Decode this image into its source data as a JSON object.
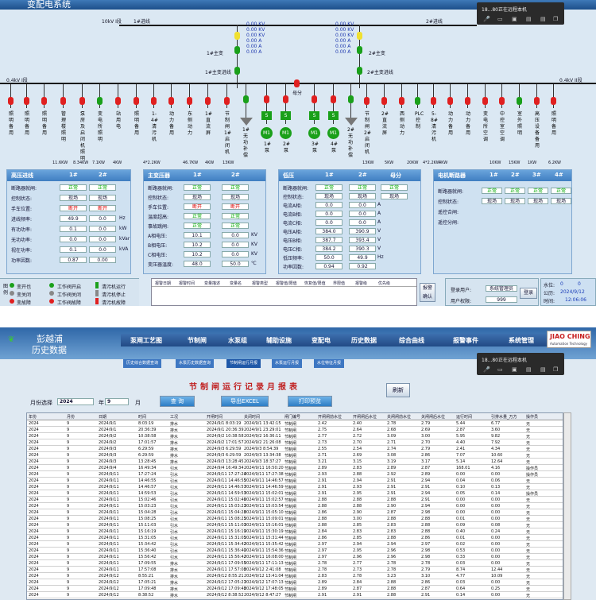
{
  "screen1": {
    "window_title": "变配电系统",
    "recorder": {
      "title": "18...80正在远程本机",
      "icons": [
        "microphone-icon",
        "video-icon",
        "monitor-icon",
        "folder-icon",
        "folder-icon",
        "window-icon"
      ]
    },
    "bus_10kv_1": "10kV I段",
    "bus_10kv_2": "2#进线",
    "incoming_1": "1#进线",
    "transformer_1": "1#主变",
    "transformer_2": "2#主变",
    "transformer_1_line": "1#主变进线",
    "transformer_2_line": "2#主变进线",
    "kv_readouts_left": [
      "0.00 KV",
      "0.00 KV",
      "0.00 KV",
      "0.00 A",
      "0.00 A",
      "0.00 A"
    ],
    "kv_readouts_right": [
      "0.00 KV",
      "0.00 KV",
      "0.00 KV",
      "0.00 A",
      "0.00 A",
      "0.00 A"
    ],
    "low_bus_left": "0.4kV I段",
    "low_bus_right": "0.4kV II段",
    "bus_coupler": "母分",
    "feeders_left": [
      "照明备用",
      "照明备用",
      "照明备用",
      "管理楼照明",
      "泵房及启闭机照明",
      "变电所照明",
      "站用电",
      "照明备用",
      "1-4#清污机",
      "动力备用",
      "东侧动力",
      "1#直流屏",
      "节制闸1#启闭机"
    ],
    "pump_labels": [
      "1#无功补偿",
      "1#泵",
      "2#泵",
      "3#泵",
      "4#泵",
      "2#无功补偿"
    ],
    "motor_label": "M1",
    "s_label": "S",
    "feeders_right": [
      "节制闸2#启闭机",
      "2#直流屏",
      "西侧动力",
      "PLC控制",
      "5-8#清污机",
      "动力备用",
      "动力备用",
      "变电所空调",
      "中控室空调",
      "室外照明",
      "高压设备备用",
      "照明备用"
    ],
    "feeder_powers": [
      "11.6KW",
      "8.34KW",
      "7.1KW",
      "4KW",
      "4*2.2KW",
      "46.7KW",
      "4KW",
      "13KW",
      "13KW",
      "5KW",
      "20KW",
      "4*2.2KW",
      "4KW",
      "10KW",
      "15KW",
      "1KW",
      "6.2KW"
    ],
    "panels": {
      "hv": {
        "title": "高压进线",
        "cols": [
          "1#",
          "2#"
        ],
        "rows": [
          {
            "label": "断路器就闸:",
            "v1": "正常",
            "v2": "正常",
            "u": ""
          },
          {
            "label": "控制状态:",
            "v1": "现场",
            "v2": "现场",
            "u": ""
          },
          {
            "label": "手车位置:",
            "v1": "断开",
            "v2": "断开",
            "u": ""
          },
          {
            "label": "进线频率:",
            "v1": "49.9",
            "v2": "0.0",
            "u": "Hz"
          },
          {
            "label": "有功功率:",
            "v1": "0.1",
            "v2": "0.0",
            "u": "kW"
          },
          {
            "label": "无功功率:",
            "v1": "0.0",
            "v2": "0.0",
            "u": "kVar"
          },
          {
            "label": "视在功率:",
            "v1": "0.1",
            "v2": "0.0",
            "u": "kVA"
          },
          {
            "label": "功率因数:",
            "v1": "0.87",
            "v2": "0.00",
            "u": ""
          }
        ]
      },
      "tr": {
        "title": "主变压器",
        "cols": [
          "1#",
          "2#"
        ],
        "rows": [
          {
            "label": "断路器就闸:",
            "v1": "正常",
            "v2": "正常",
            "u": ""
          },
          {
            "label": "控制状态:",
            "v1": "现场",
            "v2": "现场",
            "u": ""
          },
          {
            "label": "手车位置:",
            "v1": "断开",
            "v2": "断开",
            "u": ""
          },
          {
            "label": "温度超高:",
            "v1": "正常",
            "v2": "正常",
            "u": ""
          },
          {
            "label": "事故跳闸:",
            "v1": "正常",
            "v2": "正常",
            "u": ""
          },
          {
            "label": "A相电压:",
            "v1": "10.1",
            "v2": "0.0",
            "u": "KV"
          },
          {
            "label": "B相电压:",
            "v1": "10.2",
            "v2": "0.0",
            "u": "KV"
          },
          {
            "label": "C相电压:",
            "v1": "10.2",
            "v2": "0.0",
            "u": "KV"
          },
          {
            "label": "变压器温度:",
            "v1": "48.0",
            "v2": "50.0",
            "u": "℃"
          }
        ]
      },
      "lv": {
        "title": "低压",
        "cols": [
          "1#",
          "2#",
          "母分"
        ],
        "rows": [
          {
            "label": "断路器就闸:",
            "v1": "正常",
            "v2": "正常",
            "v3": "正常",
            "u": ""
          },
          {
            "label": "控制状态:",
            "v1": "现场",
            "v2": "现场",
            "v3": "现场",
            "u": ""
          },
          {
            "label": "电流A相:",
            "v1": "0.0",
            "v2": "0.0",
            "u": "A"
          },
          {
            "label": "电流B相:",
            "v1": "0.0",
            "v2": "0.0",
            "u": "A"
          },
          {
            "label": "电流C相:",
            "v1": "0.0",
            "v2": "0.0",
            "u": "A"
          },
          {
            "label": "电压A相:",
            "v1": "384.0",
            "v2": "390.9",
            "u": "V"
          },
          {
            "label": "电压B相:",
            "v1": "387.7",
            "v2": "393.4",
            "u": "V"
          },
          {
            "label": "电压C相:",
            "v1": "384.2",
            "v2": "390.3",
            "u": "V"
          },
          {
            "label": "低压频率:",
            "v1": "50.0",
            "v2": "49.9",
            "u": "Hz"
          },
          {
            "label": "功率因数:",
            "v1": "0.94",
            "v2": "0.92",
            "u": ""
          }
        ]
      },
      "motor": {
        "title": "电机断路器",
        "cols": [
          "1#",
          "2#",
          "3#",
          "4#"
        ],
        "rows": [
          {
            "label": "断路器就闸:",
            "v": [
              "正常",
              "正常",
              "正常",
              "正常"
            ]
          },
          {
            "label": "控制状态:",
            "v": [
              "现场",
              "现场",
              "现场",
              "现场"
            ]
          },
          {
            "label": "遥控合闸:",
            "v": []
          },
          {
            "label": "遥控分闸:",
            "v": []
          }
        ]
      }
    },
    "legend": {
      "title": "图例",
      "items": [
        "变开也",
        "变关闭",
        "变故障",
        "工作阀开启",
        "工作阀关闭",
        "工作阀故障",
        "清污机运行",
        "清污机停止",
        "清污机故障"
      ]
    },
    "event_table_headers": [
      "报警日期",
      "报警时间",
      "变量描述",
      "变量名",
      "报警类型",
      "报警值/限值",
      "恢复值/限值",
      "界限值",
      "报警级",
      "优先级"
    ],
    "alarm_confirm": [
      "报警",
      "确认"
    ],
    "login": {
      "user_label": "登录用户:",
      "user": "系统管理员",
      "perm_label": "用户权限:",
      "perm": "999",
      "button": "登录"
    },
    "status": {
      "water_label": "水位:",
      "water_a": "0",
      "water_b": "0",
      "date_label": "公历:",
      "date": "2024/9/12",
      "time_label": "时间:",
      "time": "12:06:06"
    }
  },
  "screen2": {
    "brand_top": "彭越浦",
    "brand_bottom": "历史数据",
    "nav": [
      "泵闸工艺图",
      "节制闸",
      "水泵组",
      "辅助设施",
      "变配电",
      "历史数据",
      "综合曲线",
      "报警事件",
      "系统管理"
    ],
    "logo": "JIAO CHING",
    "logo_sub": "Automation Technology",
    "recorder": {
      "title": "18...80正在远程本机"
    },
    "subtabs": [
      "历史综合数据查询",
      "水泵历史数据查询",
      "节制闸运行月报",
      "水泵运行月报",
      "水位特征月报"
    ],
    "report_title": "节制闸运行记录月报表",
    "month_label": "月份选择",
    "year_value": "2024",
    "year_unit": "年",
    "month_value": "9",
    "month_unit": "月",
    "buttons": {
      "query": "查 询",
      "export": "导出EXCEL",
      "print": "打印预览",
      "refresh": "刷新"
    },
    "headers": [
      "年份",
      "月份",
      "日期",
      "时间",
      "工况",
      "开闸时间",
      "关闭时间",
      "闸门编号",
      "开闸闸前水位",
      "开闸闸后水位",
      "关闸闸前水位",
      "关闸闸后水位",
      "运行时间",
      "引排水量_万方",
      "操作员"
    ],
    "rows": [
      [
        "2024",
        "9",
        "2024/9/1",
        "8:03:19",
        "排水",
        "2024/9/1 8:03:19",
        "2024/9/1 13:42:15",
        "节制闸",
        "2.42",
        "2.40",
        "2.78",
        "2.79",
        "5.44",
        "6.77",
        "无"
      ],
      [
        "2024",
        "9",
        "2024/9/1",
        "20:36:39",
        "排水",
        "2024/9/1 20:36:39",
        "2024/9/1 23:29:01",
        "节制闸",
        "2.75",
        "2.64",
        "2.68",
        "2.69",
        "2.87",
        "3.60",
        "无"
      ],
      [
        "2024",
        "9",
        "2024/9/2",
        "10:38:58",
        "排水",
        "2024/9/2 10:38:58",
        "2024/9/2 16:36:11",
        "节制闸",
        "2.77",
        "2.72",
        "3.09",
        "3.00",
        "5.95",
        "9.82",
        "无"
      ],
      [
        "2024",
        "9",
        "2024/9/2",
        "17:01:57",
        "排水",
        "2024/9/2 17:01:57",
        "2024/9/2 21:26:08",
        "节制闸",
        "2.73",
        "2.70",
        "2.71",
        "2.70",
        "4.40",
        "7.92",
        "无"
      ],
      [
        "2024",
        "9",
        "2024/9/3",
        "6:29:59",
        "排水",
        "2024/9/3 6:29:59",
        "2024/9/3 8:54:39",
        "节制闸",
        "2.55",
        "2.54",
        "2.74",
        "2.79",
        "2.41",
        "4.34",
        "无"
      ],
      [
        "2024",
        "9",
        "2024/9/3",
        "6:29:59",
        "排水",
        "2024/9/3 6:29:59",
        "2024/9/3 13:34:38",
        "节制闸",
        "2.71",
        "2.69",
        "3.08",
        "2.86",
        "7.07",
        "10.60",
        "无"
      ],
      [
        "2024",
        "9",
        "2024/9/3",
        "13:28:45",
        "排水",
        "2024/9/3 13:28:45",
        "2024/9/3 18:37:27",
        "节制闸",
        "3.21",
        "3.15",
        "3.19",
        "3.17",
        "5.14",
        "12.64",
        "无"
      ],
      [
        "2024",
        "9",
        "2024/9/4",
        "16:49:34",
        "引水",
        "2024/9/4 16:49:34",
        "2024/9/11 16:50:20",
        "节制闸",
        "2.89",
        "2.83",
        "2.89",
        "2.87",
        "168.01",
        "4.16",
        "操作员"
      ],
      [
        "2024",
        "9",
        "2024/9/11",
        "17:27:24",
        "引水",
        "2024/9/11 17:27:24",
        "2024/9/11 17:27:38",
        "节制闸",
        "2.93",
        "2.88",
        "2.92",
        "2.89",
        "0.00",
        "0.00",
        "操作员"
      ],
      [
        "2024",
        "9",
        "2024/9/11",
        "14:46:55",
        "引水",
        "2024/9/11 14:46:55",
        "2024/9/11 14:46:57",
        "节制闸",
        "2.91",
        "2.94",
        "2.91",
        "2.94",
        "0.04",
        "0.06",
        "无"
      ],
      [
        "2024",
        "9",
        "2024/9/11",
        "14:46:57",
        "引水",
        "2024/9/11 14:46:57",
        "2024/9/11 14:46:59",
        "节制闸",
        "2.91",
        "2.93",
        "2.91",
        "2.91",
        "0.10",
        "0.13",
        "无"
      ],
      [
        "2024",
        "9",
        "2024/9/11",
        "14:59:53",
        "引水",
        "2024/9/11 14:59:53",
        "2024/9/11 15:02:01",
        "节制闸",
        "2.91",
        "2.95",
        "2.91",
        "2.94",
        "0.05",
        "0.14",
        "操作员"
      ],
      [
        "2024",
        "9",
        "2024/9/11",
        "15:02:46",
        "引水",
        "2024/9/11 15:02:46",
        "2024/9/11 15:02:57",
        "节制闸",
        "2.88",
        "2.88",
        "2.88",
        "2.91",
        "0.00",
        "0.00",
        "无"
      ],
      [
        "2024",
        "9",
        "2024/9/11",
        "15:03:23",
        "引水",
        "2024/9/11 15:03:23",
        "2024/9/11 15:03:54",
        "节制闸",
        "2.88",
        "2.88",
        "2.90",
        "2.94",
        "0.00",
        "0.00",
        "无"
      ],
      [
        "2024",
        "9",
        "2024/9/11",
        "15:04:28",
        "引水",
        "2024/9/11 15:04:28",
        "2024/9/11 15:05:10",
        "节制闸",
        "2.86",
        "2.90",
        "2.87",
        "2.98",
        "0.00",
        "0.00",
        "无"
      ],
      [
        "2024",
        "9",
        "2024/9/11",
        "15:08:25",
        "引水",
        "2024/9/11 15:08:25",
        "2024/9/11 15:09:01",
        "节制闸",
        "2.88",
        "3.00",
        "2.88",
        "2.88",
        "0.01",
        "0.00",
        "无"
      ],
      [
        "2024",
        "9",
        "2024/9/11",
        "15:11:03",
        "引水",
        "2024/9/11 15:11:03",
        "2024/9/11 15:16:01",
        "节制闸",
        "2.88",
        "2.85",
        "2.83",
        "2.88",
        "0.09",
        "0.08",
        "无"
      ],
      [
        "2024",
        "9",
        "2024/9/11",
        "15:16:19",
        "引水",
        "2024/9/11 15:16:19",
        "2024/9/11 15:30:19",
        "节制闸",
        "2.84",
        "2.83",
        "2.83",
        "2.88",
        "0.40",
        "0.24",
        "无"
      ],
      [
        "2024",
        "9",
        "2024/9/11",
        "15:31:05",
        "引水",
        "2024/9/11 15:31:05",
        "2024/9/11 15:31:44",
        "节制闸",
        "2.86",
        "2.85",
        "2.88",
        "2.86",
        "0.01",
        "0.00",
        "无"
      ],
      [
        "2024",
        "9",
        "2024/9/11",
        "15:34:42",
        "引水",
        "2024/9/11 15:34:42",
        "2024/9/11 15:35:42",
        "节制闸",
        "2.97",
        "2.94",
        "2.94",
        "2.97",
        "0.02",
        "0.00",
        "无"
      ],
      [
        "2024",
        "9",
        "2024/9/11",
        "15:36:40",
        "引水",
        "2024/9/11 15:36:40",
        "2024/9/11 15:54:36",
        "节制闸",
        "2.97",
        "2.95",
        "2.96",
        "2.98",
        "0.53",
        "0.00",
        "无"
      ],
      [
        "2024",
        "9",
        "2024/9/11",
        "15:56:42",
        "引水",
        "2024/9/11 15:56:42",
        "2024/9/11 16:08:00",
        "节制闸",
        "2.97",
        "2.96",
        "2.96",
        "2.98",
        "0.33",
        "0.00",
        "无"
      ],
      [
        "2024",
        "9",
        "2024/9/11",
        "17:09:55",
        "排水",
        "2024/9/11 17:09:55",
        "2024/9/11 17:11:13",
        "节制闸",
        "2.78",
        "2.77",
        "2.78",
        "2.78",
        "0.03",
        "0.00",
        "无"
      ],
      [
        "2024",
        "9",
        "2024/9/11",
        "17:57:08",
        "排水",
        "2024/9/11 17:57:08",
        "2024/9/12 2:41:08",
        "节制闸",
        "2.78",
        "2.73",
        "2.78",
        "2.79",
        "8.74",
        "12.44",
        "无"
      ],
      [
        "2024",
        "9",
        "2024/9/12",
        "8:55:21",
        "排水",
        "2024/9/12 8:55:21",
        "2024/9/12 13:41:04",
        "节制闸",
        "2.83",
        "2.78",
        "3.23",
        "3.10",
        "4.77",
        "10.09",
        "无"
      ],
      [
        "2024",
        "9",
        "2024/9/12",
        "17:05:21",
        "排水",
        "2024/9/12 17:05:21",
        "2024/9/12 17:07:13",
        "节制闸",
        "2.89",
        "2.84",
        "2.88",
        "2.86",
        "0.03",
        "0.00",
        "无"
      ],
      [
        "2024",
        "9",
        "2024/9/12",
        "17:09:48",
        "排水",
        "2024/9/12 17:09:48",
        "2024/9/12 17:48:05",
        "节制闸",
        "2.89",
        "2.87",
        "2.88",
        "2.87",
        "0.64",
        "0.25",
        "无"
      ],
      [
        "2024",
        "9",
        "2024/9/12",
        "8:38:52",
        "排水",
        "2024/9/12 8:38:52",
        "2024/9/12 8:47:27",
        "节制闸",
        "2.91",
        "2.91",
        "2.88",
        "2.91",
        "0.14",
        "0.00",
        "无"
      ],
      [
        "2024",
        "9",
        "2024/9/12",
        "8:38:52",
        "排水",
        "2024/9/12 8:38:52",
        "2024/9/12 8:47:27",
        "节制闸",
        "2.91",
        "2.91",
        "2.88",
        "2.91",
        "0.14",
        "0.00",
        "无"
      ]
    ]
  }
}
